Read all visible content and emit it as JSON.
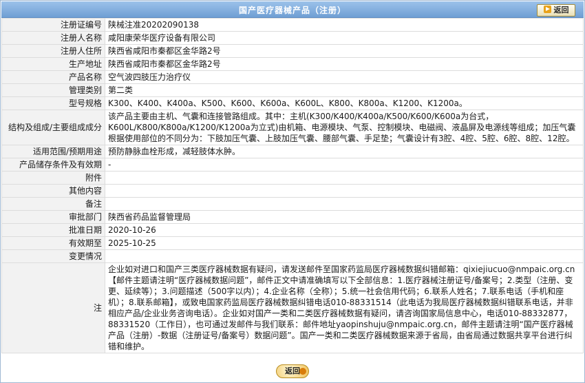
{
  "header": {
    "title": "国产医疗器械产品（注册）",
    "back_label": "返回"
  },
  "rows": [
    {
      "label": "注册证编号",
      "value": "陕械注准20202090138"
    },
    {
      "label": "注册人名称",
      "value": "咸阳康荣华医疗设备有限公司"
    },
    {
      "label": "注册人住所",
      "value": "陕西省咸阳市秦都区金华路2号"
    },
    {
      "label": "生产地址",
      "value": "陕西省咸阳市秦都区金华路2号"
    },
    {
      "label": "产品名称",
      "value": "空气波四肢压力治疗仪"
    },
    {
      "label": "管理类别",
      "value": "第二类"
    },
    {
      "label": "型号规格",
      "value": "K300、K400、K400a、K500、K600、K600a、K600L、K800、K800a、K1200、K1200a。"
    },
    {
      "label": "结构及组成/主要组成成分",
      "value": "该产品主要由主机、气囊和连接管路组成。其中：主机(K300/K400/K400a/K500/K600/K600a为台式，K600L/K800/K800a/K1200/K1200a为立式)由机箱、电源模块、气泵、控制模块、电磁阀、液晶屏及电源线等组成；加压气囊根据使用部位的不同分为：下肢加压气囊、上肢加压气囊、腰部气囊、手足垫；气囊设计有3腔、4腔、5腔、6腔、8腔、12腔。"
    },
    {
      "label": "适用范围/预期用途",
      "value": "预防静脉血栓形成，减轻肢体水肿。"
    },
    {
      "label": "产品储存条件及有效期",
      "value": "-"
    },
    {
      "label": "附件",
      "value": ""
    },
    {
      "label": "其他内容",
      "value": ""
    },
    {
      "label": "备注",
      "value": ""
    },
    {
      "label": "审批部门",
      "value": "陕西省药品监督管理局"
    },
    {
      "label": "批准日期",
      "value": "2020-10-26"
    },
    {
      "label": "有效期至",
      "value": "2025-10-25"
    },
    {
      "label": "变更情况",
      "value": ""
    }
  ],
  "note": {
    "label": "注",
    "text": "企业如对进口和国产三类医疗器械数据有疑问，请发送邮件至国家药监局医疗器械数据纠错邮箱：qixiejiucuo@nmpaic.org.cn【邮件主题请注明“医疗器械数据问题”，邮件正文中请准确填写以下全部信息：1.医疗器械注册证号/备案号；2.类型（注册、变更、延续等）；3.问题描述（500字以内）；4.企业名称（全称）；5.统一社会信用代码；6.联系人姓名；7.联系电话（手机和座机）；8.联系邮箱】，或致电国家药监局医疗器械数据纠错电话010-88331514（此电话为我局医疗器械数据纠错联系电话，并非相应产品/企业业务咨询电话）。企业如对国产一类和二类医疗器械数据有疑问，请咨询国家局信息中心，电话010-88332877，88331520（工作日），也可通过发邮件与我们联系：邮件地址yaopinshuju@nmpaic.org.cn，邮件主题请注明“国产医疗器械产品（注册）-数据（注册证号/备案号）数据问题”。国产一类和二类医疗器械数据来源于省局，由省局通过数据共享平台进行纠错和维护。"
  },
  "footer": {
    "back_label": "返回"
  },
  "colors": {
    "header_bg": "#7aa8da",
    "label_bg": "#f2f2f2",
    "border": "#dcdcdc"
  }
}
